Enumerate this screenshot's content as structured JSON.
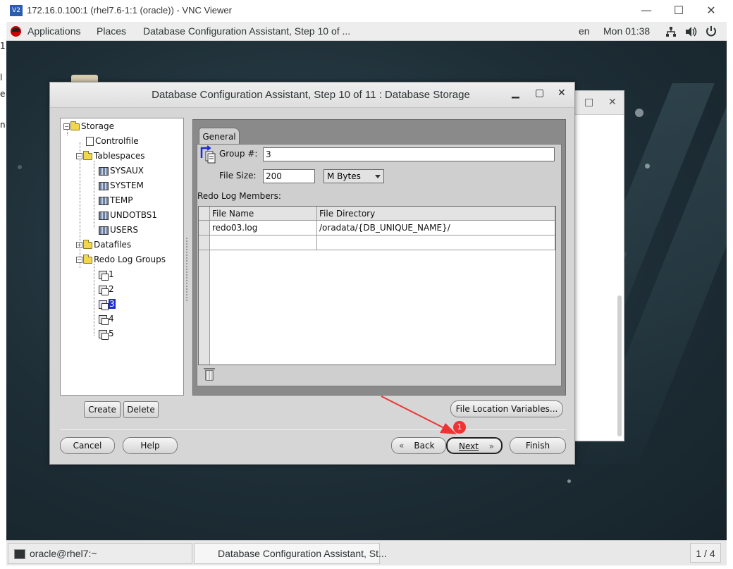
{
  "vnc": {
    "logo": "V2",
    "title": "172.16.0.100:1 (rhel7.6-1:1 (oracle)) - VNC Viewer",
    "minimize": "—",
    "maximize": "☐",
    "close": "✕"
  },
  "topbar": {
    "applications": "Applications",
    "places": "Places",
    "active_window": "Database Configuration Assistant, Step 10 of ...",
    "lang": "en",
    "clock": "Mon 01:38",
    "network_icon": "network-icon",
    "volume_icon": "volume-icon",
    "power_icon": "power-icon"
  },
  "dialog": {
    "title": "Database Configuration Assistant, Step 10 of 11 : Database Storage",
    "minimize": "▁",
    "maximize": "▢",
    "close": "✕",
    "tree": {
      "storage": "Storage",
      "controlfile": "Controlfile",
      "tablespaces": "Tablespaces",
      "sysaux": "SYSAUX",
      "system": "SYSTEM",
      "temp": "TEMP",
      "undotbs1": "UNDOTBS1",
      "users": "USERS",
      "datafiles": "Datafiles",
      "redo_log_groups": "Redo Log Groups",
      "groups": [
        "1",
        "2",
        "3",
        "4",
        "5"
      ],
      "selected_group": "3"
    },
    "tab": "General",
    "group_label": "Group #:",
    "group_value": "3",
    "filesize_label": "File Size:",
    "filesize_value": "200",
    "unit_value": "M Bytes",
    "members_label": "Redo Log Members:",
    "table": {
      "headers": [
        "File Name",
        "File Directory"
      ],
      "rows": [
        [
          "redo03.log",
          "/oradata/{DB_UNIQUE_NAME}/"
        ],
        [
          "",
          ""
        ]
      ]
    },
    "buttons": {
      "create": "Create",
      "delete": "Delete",
      "file_location_variables": "File Location Variables...",
      "cancel": "Cancel",
      "help": "Help",
      "back": "Back",
      "next": "Next",
      "finish": "Finish"
    }
  },
  "annotation": {
    "badge": "1",
    "color": "#ee3333"
  },
  "taskbar": {
    "terminal": "oracle@rhel7:~",
    "dbca": "Database Configuration Assistant, St...",
    "pager": "1 / 4"
  },
  "bg_window": {
    "minimize": "□",
    "close": "✕"
  }
}
